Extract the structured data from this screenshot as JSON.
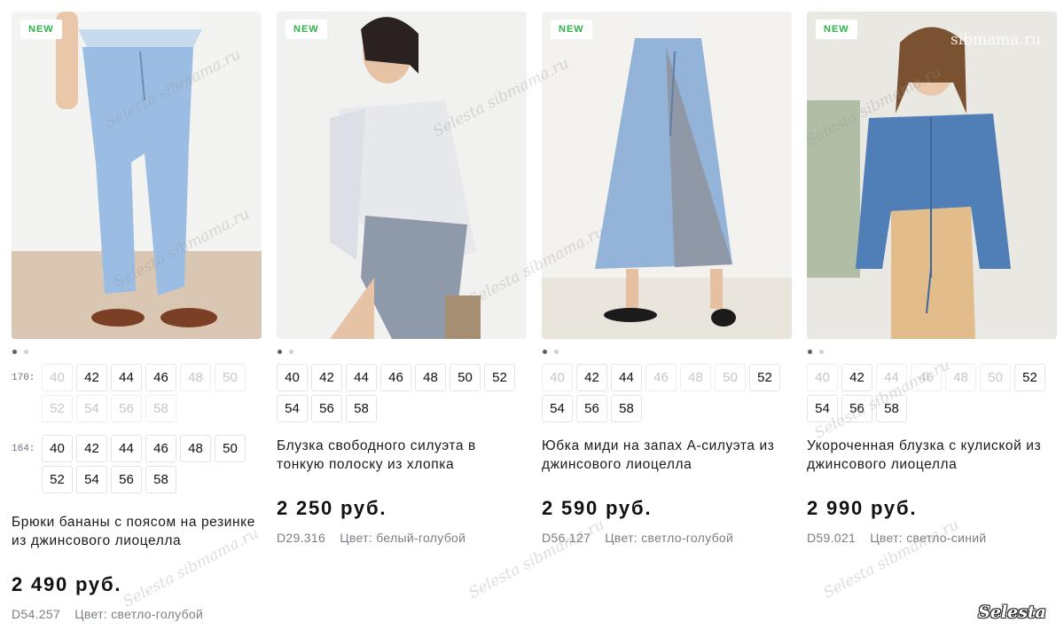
{
  "badge_label": "NEW",
  "watermark_text": "Selesta sibmama.ru",
  "corner_watermark": "sibmama.ru",
  "brand_logo": "Selesta",
  "color_prefix": "Цвет:",
  "products": [
    {
      "title": "Брюки бананы с поясом на резинке из джинсового лиоцелла",
      "price": "2 490 руб.",
      "sku": "D54.257",
      "color": "светло-голубой",
      "size_groups": [
        {
          "label": "170:",
          "sizes": [
            {
              "v": "40",
              "a": false
            },
            {
              "v": "42",
              "a": true
            },
            {
              "v": "44",
              "a": true
            },
            {
              "v": "46",
              "a": true
            },
            {
              "v": "48",
              "a": false
            },
            {
              "v": "50",
              "a": false
            },
            {
              "v": "52",
              "a": false
            },
            {
              "v": "54",
              "a": false
            },
            {
              "v": "56",
              "a": false
            },
            {
              "v": "58",
              "a": false
            }
          ]
        },
        {
          "label": "164:",
          "sizes": [
            {
              "v": "40",
              "a": true
            },
            {
              "v": "42",
              "a": true
            },
            {
              "v": "44",
              "a": true
            },
            {
              "v": "46",
              "a": true
            },
            {
              "v": "48",
              "a": true
            },
            {
              "v": "50",
              "a": true
            },
            {
              "v": "52",
              "a": true
            },
            {
              "v": "54",
              "a": true
            },
            {
              "v": "56",
              "a": true
            },
            {
              "v": "58",
              "a": true
            }
          ]
        }
      ]
    },
    {
      "title": "Блузка свободного силуэта в тонкую полоску из хлопка",
      "price": "2 250 руб.",
      "sku": "D29.316",
      "color": "белый-голубой",
      "size_groups": [
        {
          "label": "",
          "sizes": [
            {
              "v": "40",
              "a": true
            },
            {
              "v": "42",
              "a": true
            },
            {
              "v": "44",
              "a": true
            },
            {
              "v": "46",
              "a": true
            },
            {
              "v": "48",
              "a": true
            },
            {
              "v": "50",
              "a": true
            },
            {
              "v": "52",
              "a": true
            },
            {
              "v": "54",
              "a": true
            },
            {
              "v": "56",
              "a": true
            },
            {
              "v": "58",
              "a": true
            }
          ]
        }
      ]
    },
    {
      "title": "Юбка миди на запах А-силуэта из джинсового лиоцелла",
      "price": "2 590 руб.",
      "sku": "D56.127",
      "color": "светло-голубой",
      "size_groups": [
        {
          "label": "",
          "sizes": [
            {
              "v": "40",
              "a": false
            },
            {
              "v": "42",
              "a": true
            },
            {
              "v": "44",
              "a": true
            },
            {
              "v": "46",
              "a": false
            },
            {
              "v": "48",
              "a": false
            },
            {
              "v": "50",
              "a": false
            },
            {
              "v": "52",
              "a": true
            },
            {
              "v": "54",
              "a": true
            },
            {
              "v": "56",
              "a": true
            },
            {
              "v": "58",
              "a": true
            }
          ]
        }
      ]
    },
    {
      "title": "Укороченная блузка с кулиской из джинсового лиоцелла",
      "price": "2 990 руб.",
      "sku": "D59.021",
      "color": "светло-синий",
      "size_groups": [
        {
          "label": "",
          "sizes": [
            {
              "v": "40",
              "a": false
            },
            {
              "v": "42",
              "a": true
            },
            {
              "v": "44",
              "a": false
            },
            {
              "v": "46",
              "a": false
            },
            {
              "v": "48",
              "a": false
            },
            {
              "v": "50",
              "a": false
            },
            {
              "v": "52",
              "a": true
            },
            {
              "v": "54",
              "a": true
            },
            {
              "v": "56",
              "a": true
            },
            {
              "v": "58",
              "a": true
            }
          ]
        }
      ]
    }
  ]
}
